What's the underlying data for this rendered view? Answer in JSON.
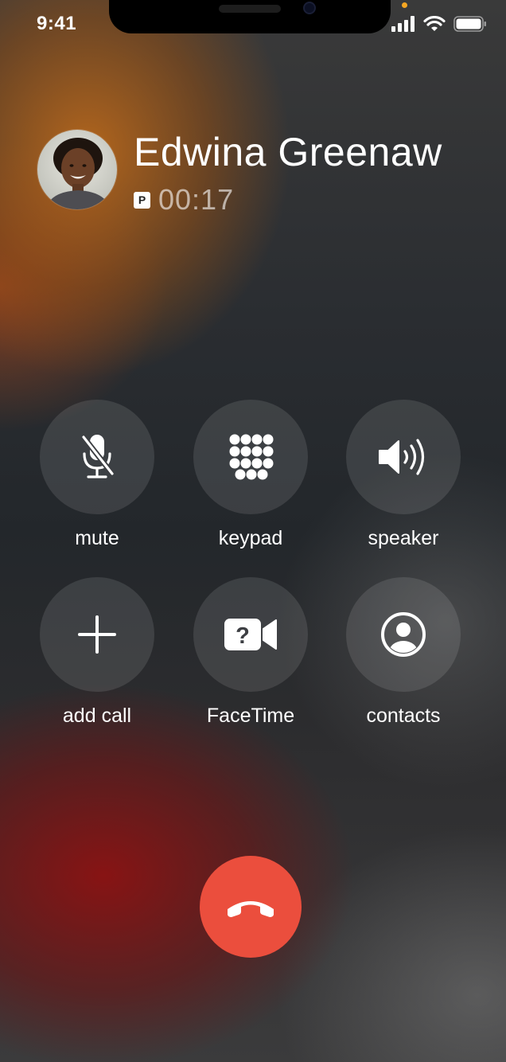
{
  "status_bar": {
    "time": "9:41",
    "icons": [
      "cellular-signal-icon",
      "wifi-icon",
      "battery-icon"
    ],
    "privacy_indicator_color": "#f5a623"
  },
  "caller": {
    "name": "Edwina Greenaw",
    "badge": "P",
    "duration": "00:17"
  },
  "controls": [
    {
      "label": "mute",
      "icon": "mic-slash-icon"
    },
    {
      "label": "keypad",
      "icon": "keypad-icon"
    },
    {
      "label": "speaker",
      "icon": "speaker-icon"
    },
    {
      "label": "add call",
      "icon": "plus-icon"
    },
    {
      "label": "FaceTime",
      "icon": "facetime-icon"
    },
    {
      "label": "contacts",
      "icon": "contact-icon"
    }
  ],
  "end_call": {
    "icon": "phone-down-icon",
    "color": "#eb4e3d"
  }
}
